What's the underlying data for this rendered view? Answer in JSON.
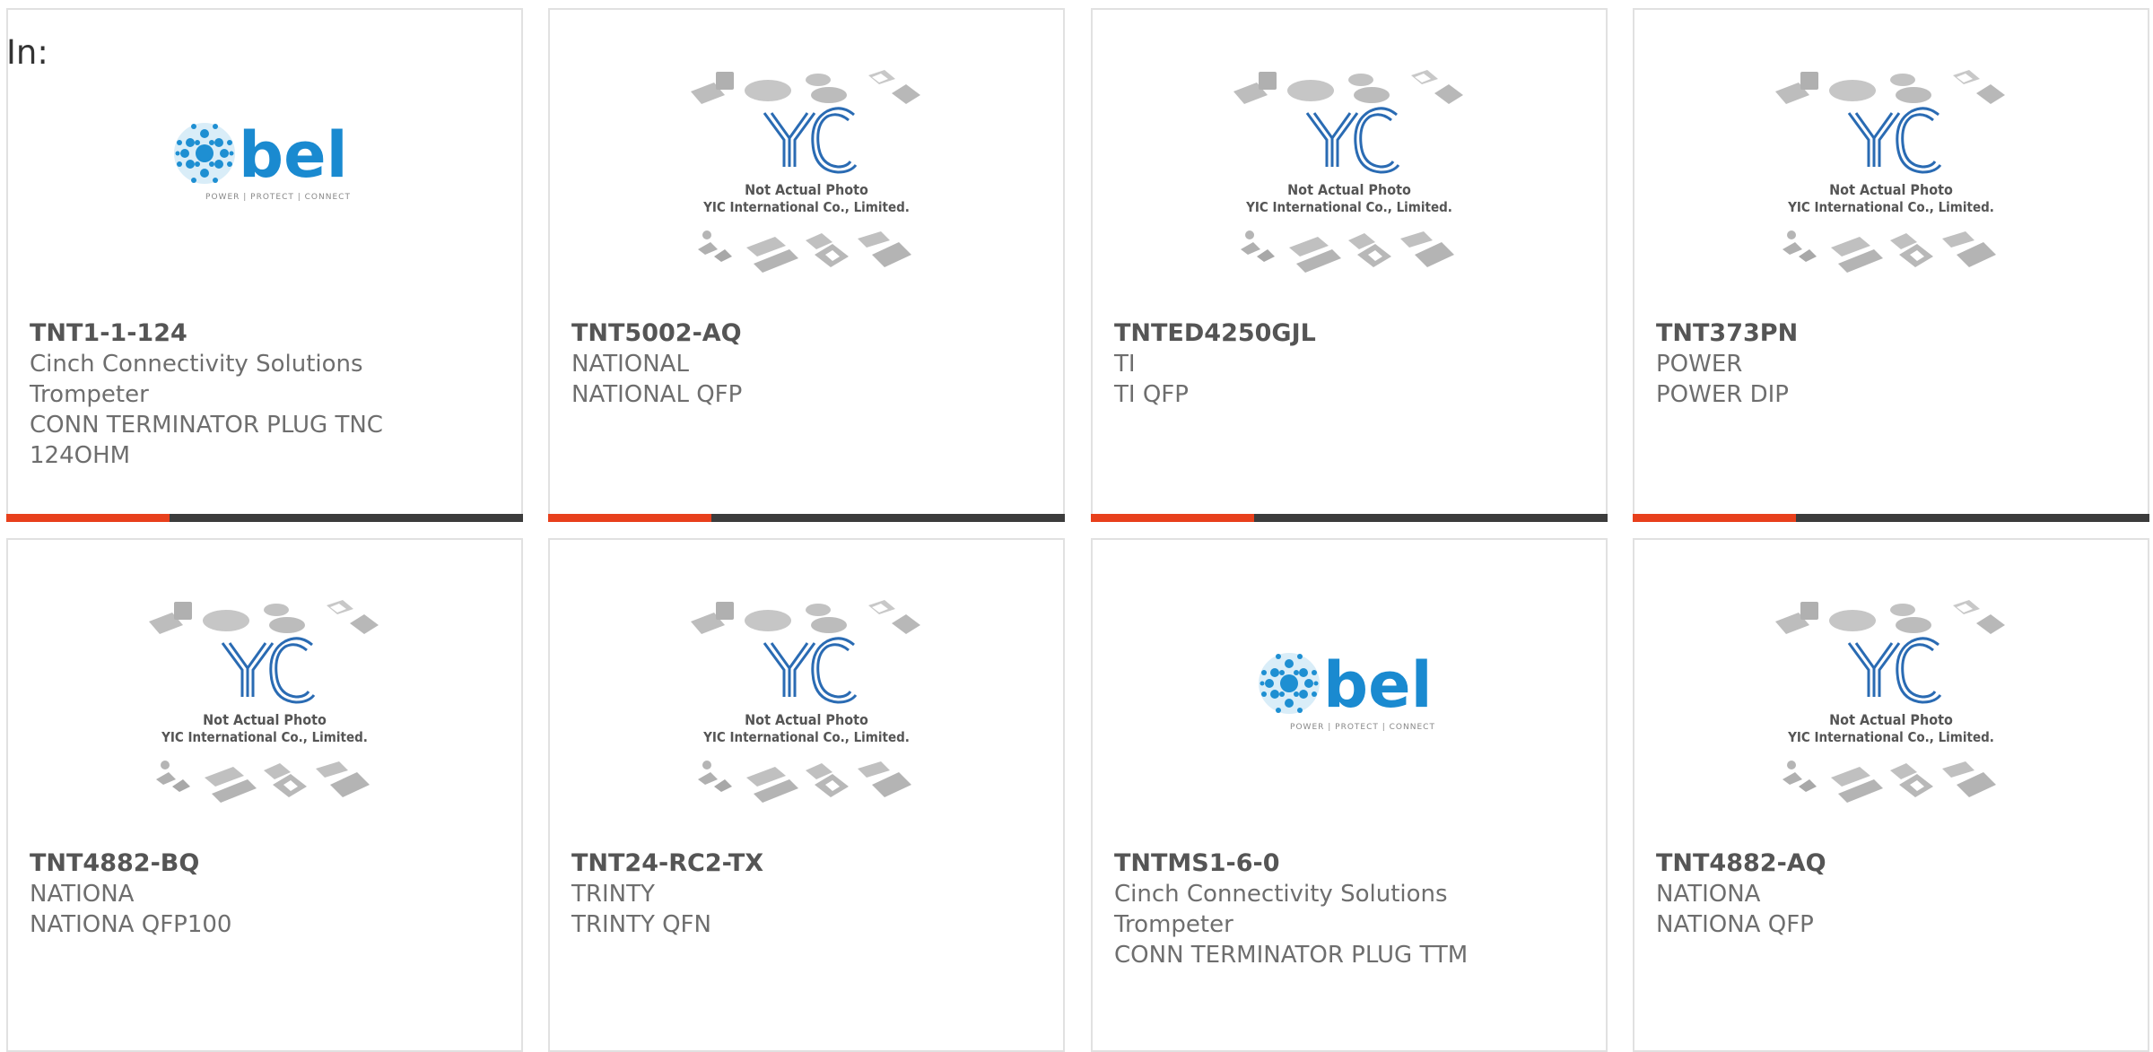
{
  "header": {
    "in_label": "In:"
  },
  "images": {
    "placeholder_line1": "Not Actual Photo",
    "placeholder_line2": "YIC International Co., Limited.",
    "placeholder_logo": "YIC",
    "bel_logo": "bel",
    "bel_tagline": "POWER | PROTECT | CONNECT"
  },
  "colors": {
    "accent": "#e8401c",
    "bar_dark": "#3c3c3c",
    "bel_blue": "#1a8ad0",
    "yic_blue": "#2a6bb3"
  },
  "products": [
    {
      "part": "TNT1-1-124",
      "lines": [
        "Cinch Connectivity Solutions",
        "Trompeter",
        "CONN TERMINATOR PLUG TNC",
        "124OHM"
      ],
      "image": "bel-logo"
    },
    {
      "part": "TNT5002-AQ",
      "lines": [
        "NATIONAL",
        "NATIONAL QFP"
      ],
      "image": "yic-placeholder"
    },
    {
      "part": "TNTED4250GJL",
      "lines": [
        "TI",
        "TI QFP"
      ],
      "image": "yic-placeholder"
    },
    {
      "part": "TNT373PN",
      "lines": [
        "POWER",
        "POWER DIP"
      ],
      "image": "yic-placeholder"
    },
    {
      "part": "TNT4882-BQ",
      "lines": [
        "NATIONA",
        "NATIONA QFP100"
      ],
      "image": "yic-placeholder"
    },
    {
      "part": "TNT24-RC2-TX",
      "lines": [
        "TRINTY",
        "TRINTY QFN"
      ],
      "image": "yic-placeholder"
    },
    {
      "part": "TNTMS1-6-0",
      "lines": [
        "Cinch Connectivity Solutions",
        "Trompeter",
        "CONN TERMINATOR PLUG TTM"
      ],
      "image": "bel-logo"
    },
    {
      "part": "TNT4882-AQ",
      "lines": [
        "NATIONA",
        "NATIONA QFP"
      ],
      "image": "yic-placeholder"
    }
  ]
}
